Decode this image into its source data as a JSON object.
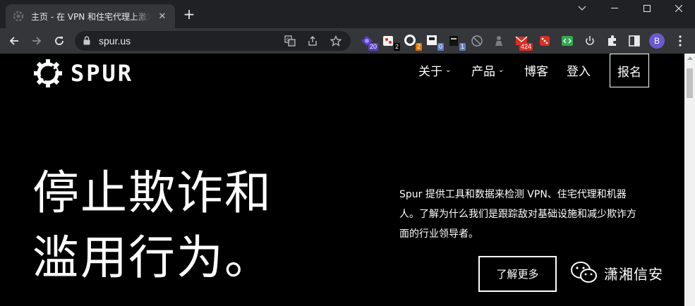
{
  "browser": {
    "tab": {
      "title": "主页 - 在 VPN 和住宅代理上激发",
      "close": "✕"
    },
    "new_tab": "+",
    "url": "spur.us",
    "extensions": [
      {
        "name": "ext-purple-icon",
        "badge": "20",
        "badge_color": "#5b3fc4"
      },
      {
        "name": "ext-cookie-icon",
        "badge": "2",
        "badge_color": "#202124"
      },
      {
        "name": "ext-ring-icon",
        "badge": "2",
        "badge_color": "#e37400"
      },
      {
        "name": "ext-tag-icon",
        "badge": "0",
        "badge_color": "#5f7fbf"
      },
      {
        "name": "ext-dark-icon",
        "badge": "1",
        "badge_color": "#5f7fbf"
      },
      {
        "name": "ext-circle-slash-icon",
        "badge": "",
        "badge_color": ""
      },
      {
        "name": "ext-figure-icon",
        "badge": "",
        "badge_color": ""
      },
      {
        "name": "ext-mail-icon",
        "badge": "424",
        "badge_color": "#d93025"
      },
      {
        "name": "ext-dice-icon",
        "badge": "",
        "badge_color": ""
      },
      {
        "name": "ext-code-icon",
        "badge": "",
        "badge_color": ""
      },
      {
        "name": "ext-power-icon",
        "badge": "",
        "badge_color": ""
      }
    ],
    "profile_initial": "B"
  },
  "site": {
    "logo_text": "SPUR",
    "nav": [
      {
        "label": "关于",
        "has_caret": true
      },
      {
        "label": "产品",
        "has_caret": true
      },
      {
        "label": "博客",
        "has_caret": false
      },
      {
        "label": "登入",
        "has_caret": false
      }
    ],
    "caret": "⌄",
    "signup": "报名"
  },
  "hero": {
    "title_line1": "停止欺诈和",
    "title_line2": "滥用行为。",
    "description": "Spur 提供工具和数据来检测 VPN、住宅代理和机器人。了解为什么我们是跟踪敌对基础设施和减少欺诈方面的行业领导者。",
    "cta": "了解更多"
  },
  "watermark": {
    "text": "潇湘信安"
  },
  "colors": {
    "chrome_dark": "#202124",
    "chrome_tab": "#35363a",
    "page_bg": "#000000",
    "text": "#ffffff"
  }
}
